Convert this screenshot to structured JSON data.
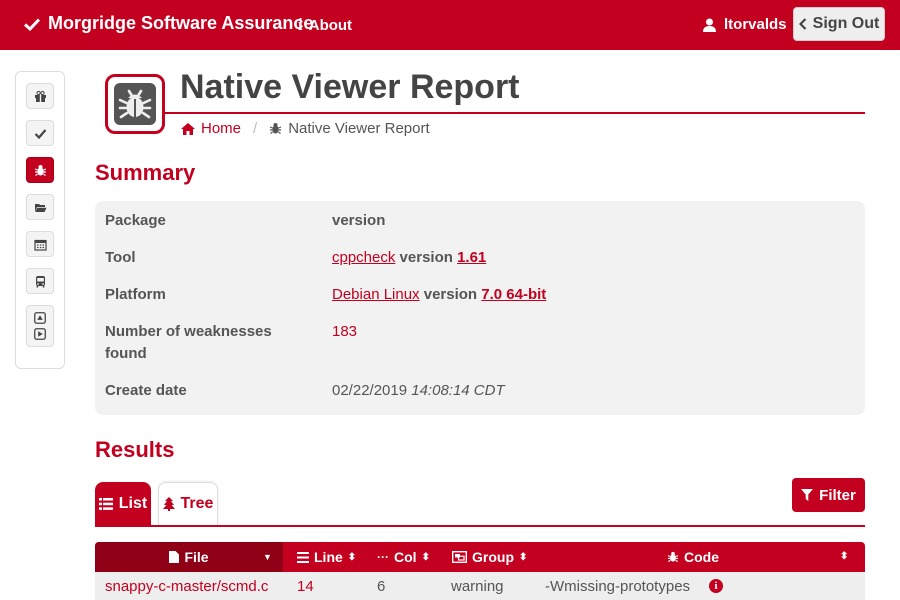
{
  "header": {
    "brand": "Morgridge Software Assurance",
    "about": "About",
    "user": "ltorvalds",
    "signout": "Sign Out"
  },
  "sidebar": {
    "items": [
      "gift-icon",
      "check-icon",
      "bug-icon",
      "folder-open-icon",
      "calendar-icon",
      "bus-icon",
      "playback-icon"
    ],
    "active": "bug-icon"
  },
  "page": {
    "title": "Native Viewer Report",
    "breadcrumb_home": "Home",
    "breadcrumb_current": "Native Viewer Report"
  },
  "summary": {
    "title": "Summary",
    "package_label": "Package",
    "package_value": "version",
    "tool_label": "Tool",
    "tool_name": "cppcheck",
    "tool_version_word": "version",
    "tool_version": "1.61",
    "platform_label": "Platform",
    "platform_name": "Debian Linux",
    "platform_version_word": "version",
    "platform_version": "7.0 64-bit",
    "weaknesses_label_1": "Number of weaknesses",
    "weaknesses_label_2": "found",
    "weaknesses_value": "183",
    "create_label": "Create date",
    "create_date": "02/22/2019",
    "create_time": "14:08:14 CDT"
  },
  "results": {
    "title": "Results",
    "tab_list": "List",
    "tab_tree": "Tree",
    "filter": "Filter",
    "columns": [
      "File",
      "Line",
      "Col",
      "Group",
      "Code"
    ],
    "rows": [
      {
        "file": "snappy-c-master/scmd.c",
        "line": "14",
        "col": "6",
        "group": "warning",
        "code": "-Wmissing-prototypes"
      }
    ]
  },
  "colors": {
    "accent": "#c3001f",
    "accent_dark": "#8f0016"
  }
}
